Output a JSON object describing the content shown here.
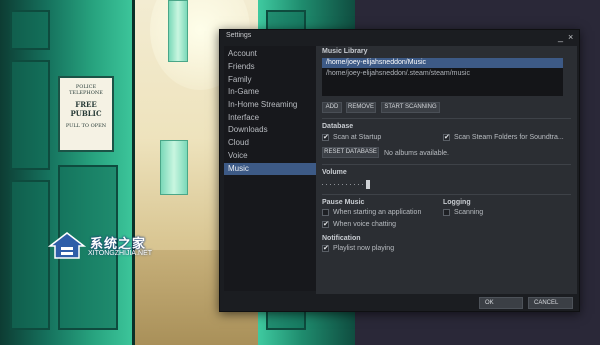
{
  "wallpaper": {
    "sign": {
      "line1": "POLICE TELEPHONE",
      "line2": "FREE",
      "line3": "PUBLIC",
      "line4": "PULL TO OPEN"
    },
    "watermark": {
      "title": "系统之家",
      "subtitle": "XITONGZHIJIA.NET"
    }
  },
  "window": {
    "title": "Settings",
    "minimize_glyph": "_",
    "close_glyph": "×"
  },
  "sidebar": {
    "items": [
      {
        "label": "Account"
      },
      {
        "label": "Friends"
      },
      {
        "label": "Family"
      },
      {
        "label": "In-Game"
      },
      {
        "label": "In-Home Streaming"
      },
      {
        "label": "Interface"
      },
      {
        "label": "Downloads"
      },
      {
        "label": "Cloud"
      },
      {
        "label": "Voice"
      },
      {
        "label": "Music"
      }
    ],
    "active": "Music"
  },
  "music_library": {
    "title": "Music Library",
    "paths": [
      "/home/joey-elijahsneddon/Music",
      "/home/joey-elijahsneddon/.steam/steam/music"
    ],
    "add_label": "ADD",
    "remove_label": "REMOVE",
    "scan_label": "START SCANNING"
  },
  "database": {
    "title": "Database",
    "scan_at_startup_label": "Scan at Startup",
    "scan_at_startup_checked": true,
    "scan_steam_label": "Scan Steam Folders for Soundtra...",
    "scan_steam_checked": true,
    "reset_label": "RESET DATABASE",
    "status": "No albums available."
  },
  "volume": {
    "title": "Volume",
    "level": 1.0
  },
  "pause_music": {
    "title": "Pause Music",
    "starting_app_label": "When starting an application",
    "starting_app_checked": false,
    "voice_chatting_label": "When voice chatting",
    "voice_chatting_checked": true
  },
  "logging": {
    "title": "Logging",
    "scanning_label": "Scanning",
    "scanning_checked": false
  },
  "notification": {
    "title": "Notification",
    "playlist_label": "Playlist now playing",
    "playlist_checked": true
  },
  "footer": {
    "ok_label": "OK",
    "cancel_label": "CANCEL"
  },
  "colors": {
    "accent": "#3d5a86",
    "window_bg": "#1b1d21",
    "content_bg": "#2b2e33"
  },
  "checkmark_glyph": "✔"
}
